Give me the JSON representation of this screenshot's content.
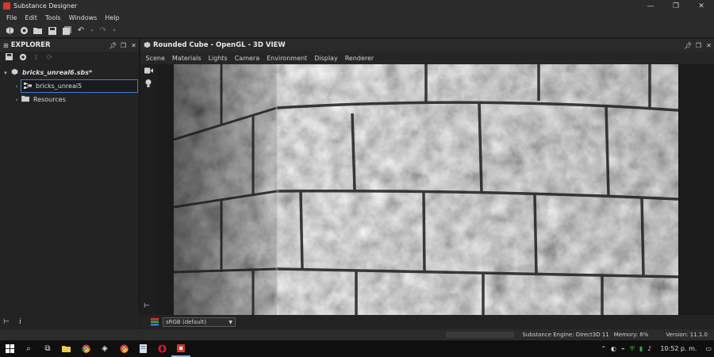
{
  "window": {
    "title": "Substance Designer",
    "controls": [
      "—",
      "❐",
      "✕"
    ]
  },
  "menu": [
    "File",
    "Edit",
    "Tools",
    "Windows",
    "Help"
  ],
  "toolbar": {
    "icons": [
      "new-package-icon",
      "new-graph-icon",
      "open-icon",
      "save-icon",
      "save-all-icon",
      "undo-icon",
      "redo-icon"
    ]
  },
  "explorer": {
    "title": "EXPLORER",
    "tree": {
      "package": "bricks_unreal6.sbs*",
      "graph": "bricks_unreal5",
      "resources": "Resources"
    },
    "info_icon_label": "i"
  },
  "view3d": {
    "title": "Rounded Cube - OpenGL - 3D VIEW",
    "tabs": [
      "Scene",
      "Materials",
      "Lights",
      "Camera",
      "Environment",
      "Display",
      "Renderer"
    ],
    "colorspace": "sRGB (default)"
  },
  "status": {
    "engine": "Substance Engine: Direct3D 11",
    "memory": "Memory: 8%",
    "version": "Version: 11.1.0"
  },
  "taskbar": {
    "time": "10:52 p. m."
  },
  "colors": {
    "accent": "#3d7bd9",
    "app_red": "#d33a2c",
    "panel_bg": "#232323"
  }
}
